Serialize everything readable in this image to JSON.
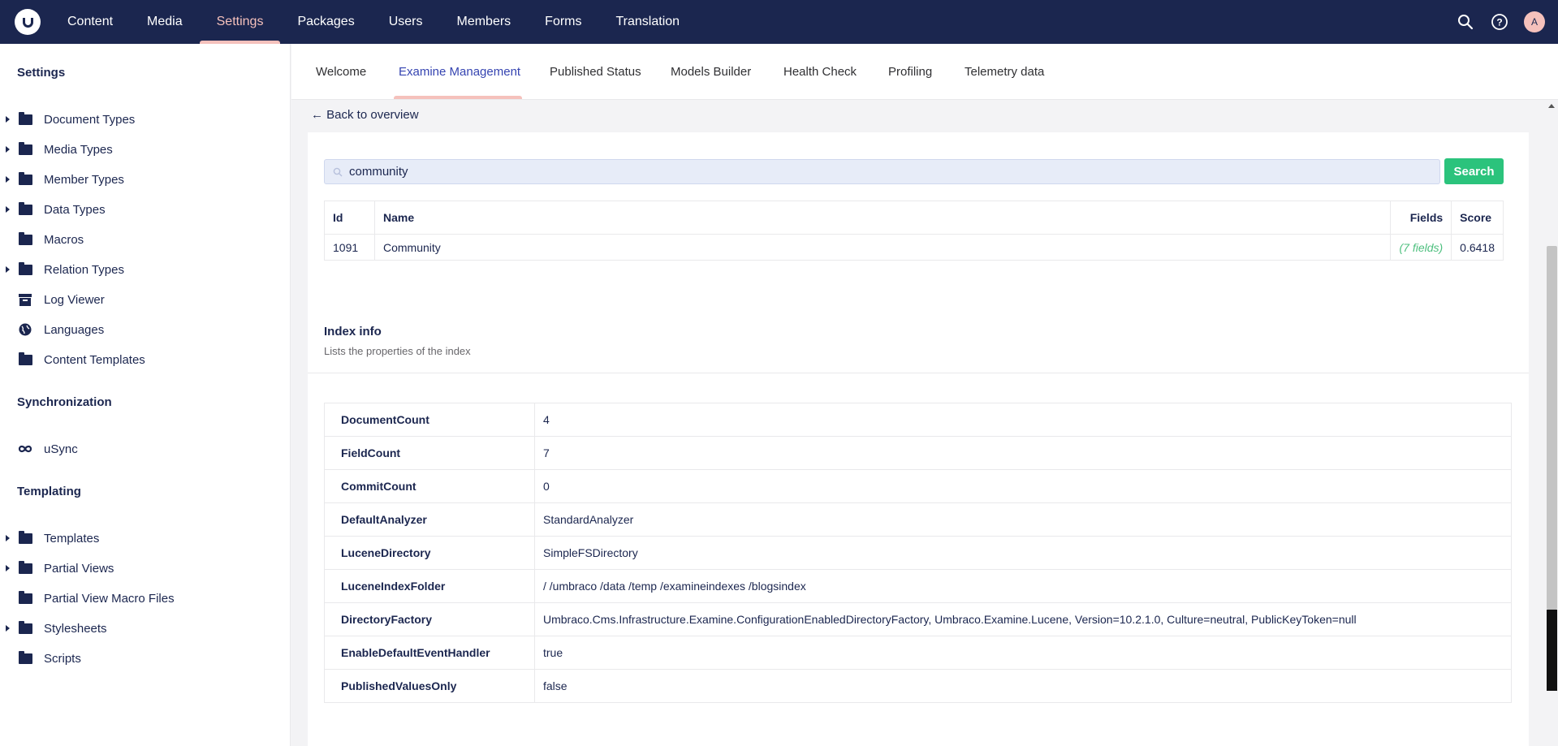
{
  "topnav": {
    "items": [
      "Content",
      "Media",
      "Settings",
      "Packages",
      "Users",
      "Members",
      "Forms",
      "Translation"
    ],
    "active": "Settings",
    "avatar_initial": "A"
  },
  "sidebar": {
    "settings_heading": "Settings",
    "settings_items": [
      {
        "label": "Document Types",
        "icon": "folder-icon",
        "expandable": true
      },
      {
        "label": "Media Types",
        "icon": "folder-icon",
        "expandable": true
      },
      {
        "label": "Member Types",
        "icon": "folder-icon",
        "expandable": true
      },
      {
        "label": "Data Types",
        "icon": "folder-icon",
        "expandable": true
      },
      {
        "label": "Macros",
        "icon": "folder-icon",
        "expandable": false
      },
      {
        "label": "Relation Types",
        "icon": "folder-icon",
        "expandable": true
      },
      {
        "label": "Log Viewer",
        "icon": "box-icon",
        "expandable": false
      },
      {
        "label": "Languages",
        "icon": "globe-icon",
        "expandable": false
      },
      {
        "label": "Content Templates",
        "icon": "folder-icon",
        "expandable": false
      }
    ],
    "sync_heading": "Synchronization",
    "sync_items": [
      {
        "label": "uSync",
        "icon": "infinity-icon",
        "expandable": false
      }
    ],
    "templating_heading": "Templating",
    "templating_items": [
      {
        "label": "Templates",
        "icon": "folder-icon",
        "expandable": true
      },
      {
        "label": "Partial Views",
        "icon": "folder-icon",
        "expandable": true
      },
      {
        "label": "Partial View Macro Files",
        "icon": "folder-icon",
        "expandable": false
      },
      {
        "label": "Stylesheets",
        "icon": "folder-icon",
        "expandable": true
      },
      {
        "label": "Scripts",
        "icon": "folder-icon",
        "expandable": false
      }
    ]
  },
  "tabs": {
    "items": [
      "Welcome",
      "Examine Management",
      "Published Status",
      "Models Builder",
      "Health Check",
      "Profiling",
      "Telemetry data"
    ],
    "active": "Examine Management"
  },
  "back_link": "← Back to overview",
  "search": {
    "value": "community",
    "button_label": "Search"
  },
  "results": {
    "headers": {
      "id": "Id",
      "name": "Name",
      "fields": "Fields",
      "score": "Score"
    },
    "rows": [
      {
        "id": "1091",
        "name": "Community",
        "fields": "(7 fields)",
        "score": "0.6418"
      }
    ]
  },
  "index_info": {
    "title": "Index info",
    "subtitle": "Lists the properties of the index",
    "properties": [
      {
        "key": "DocumentCount",
        "value": "4"
      },
      {
        "key": "FieldCount",
        "value": "7"
      },
      {
        "key": "CommitCount",
        "value": "0"
      },
      {
        "key": "DefaultAnalyzer",
        "value": "StandardAnalyzer"
      },
      {
        "key": "LuceneDirectory",
        "value": "SimpleFSDirectory"
      },
      {
        "key": "LuceneIndexFolder",
        "value": "/ /umbraco /data /temp /examineindexes /blogsindex"
      },
      {
        "key": "DirectoryFactory",
        "value": "Umbraco.Cms.Infrastructure.Examine.ConfigurationEnabledDirectoryFactory, Umbraco.Examine.Lucene, Version=10.2.1.0, Culture=neutral, PublicKeyToken=null"
      },
      {
        "key": "EnableDefaultEventHandler",
        "value": "true"
      },
      {
        "key": "PublishedValuesOnly",
        "value": "false"
      }
    ]
  },
  "colors": {
    "topbar": "#1b264f",
    "active_accent": "#f5c1bc",
    "tab_active": "#3544b1",
    "search_button": "#2bc37c"
  }
}
